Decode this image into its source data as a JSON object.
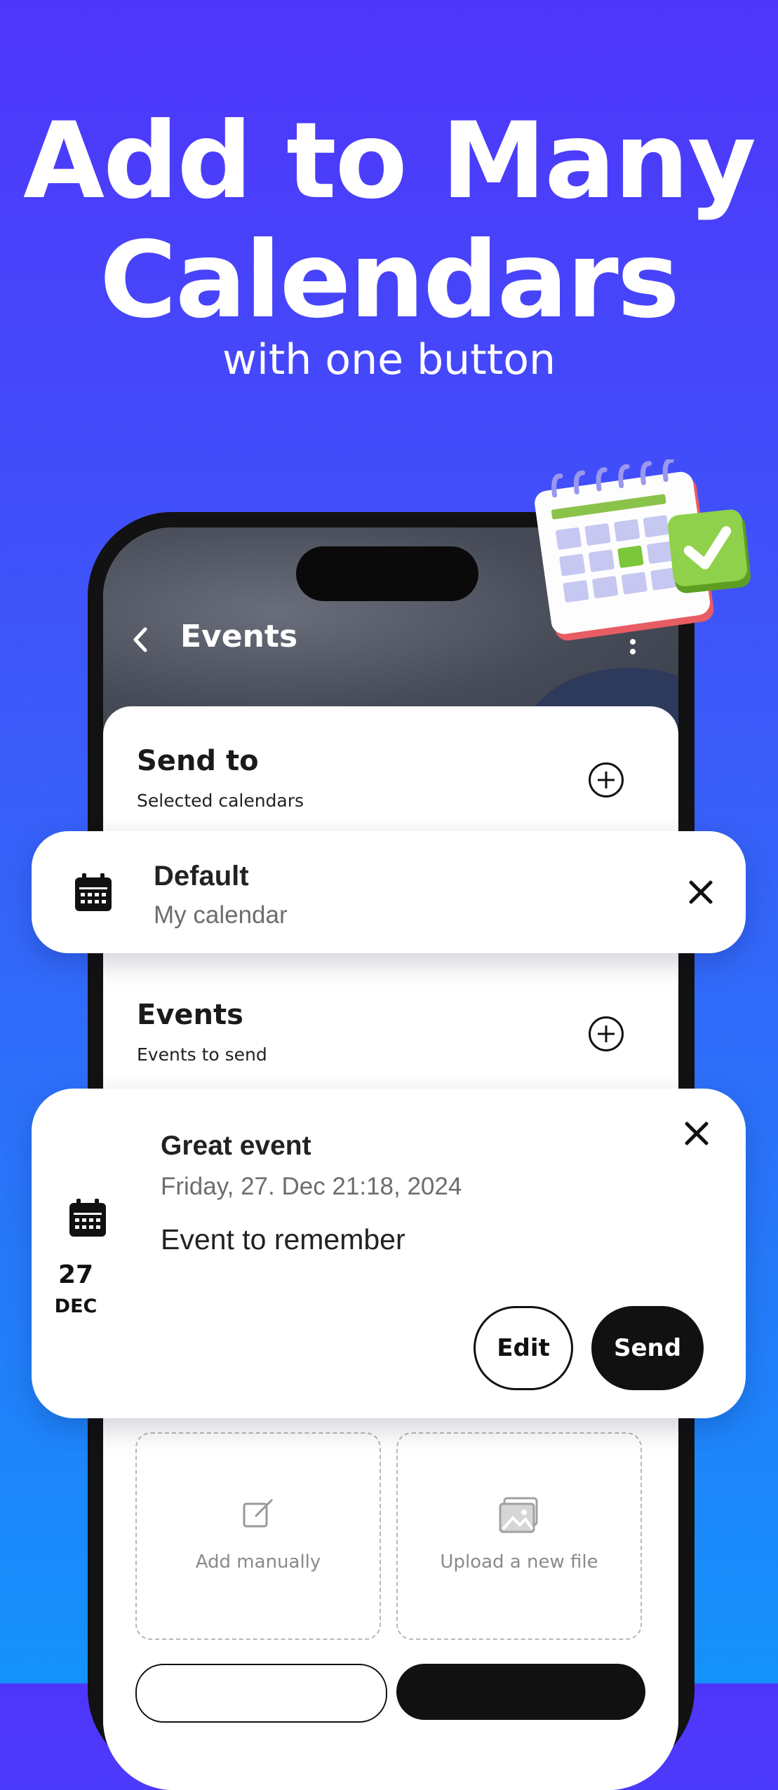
{
  "promo": {
    "headline_line1": "Add to Many",
    "headline_line2": "Calendars",
    "subheadline": "with one button"
  },
  "app": {
    "header": {
      "title": "Events"
    },
    "send_to": {
      "title": "Send to",
      "subtitle": "Selected calendars"
    },
    "events": {
      "title": "Events",
      "subtitle": "Events to send"
    },
    "tiles": [
      {
        "label": "Add manually",
        "icon": "edit-icon"
      },
      {
        "label": "Upload a new file",
        "icon": "image-icon"
      }
    ]
  },
  "calendar_card": {
    "title": "Default",
    "subtitle": "My calendar",
    "icon": "calendar-icon"
  },
  "event_card": {
    "title": "Great event",
    "datetime": "Friday, 27. Dec 21:18, 2024",
    "description": "Event to remember",
    "day": "27",
    "month": "DEC",
    "edit_label": "Edit",
    "send_label": "Send"
  },
  "colors": {
    "background_top": "#4f35fb",
    "background_bottom": "#1492fb",
    "primary_button": "#111111",
    "illustration_green": "#7cc63a",
    "illustration_red": "#f06a6a"
  }
}
